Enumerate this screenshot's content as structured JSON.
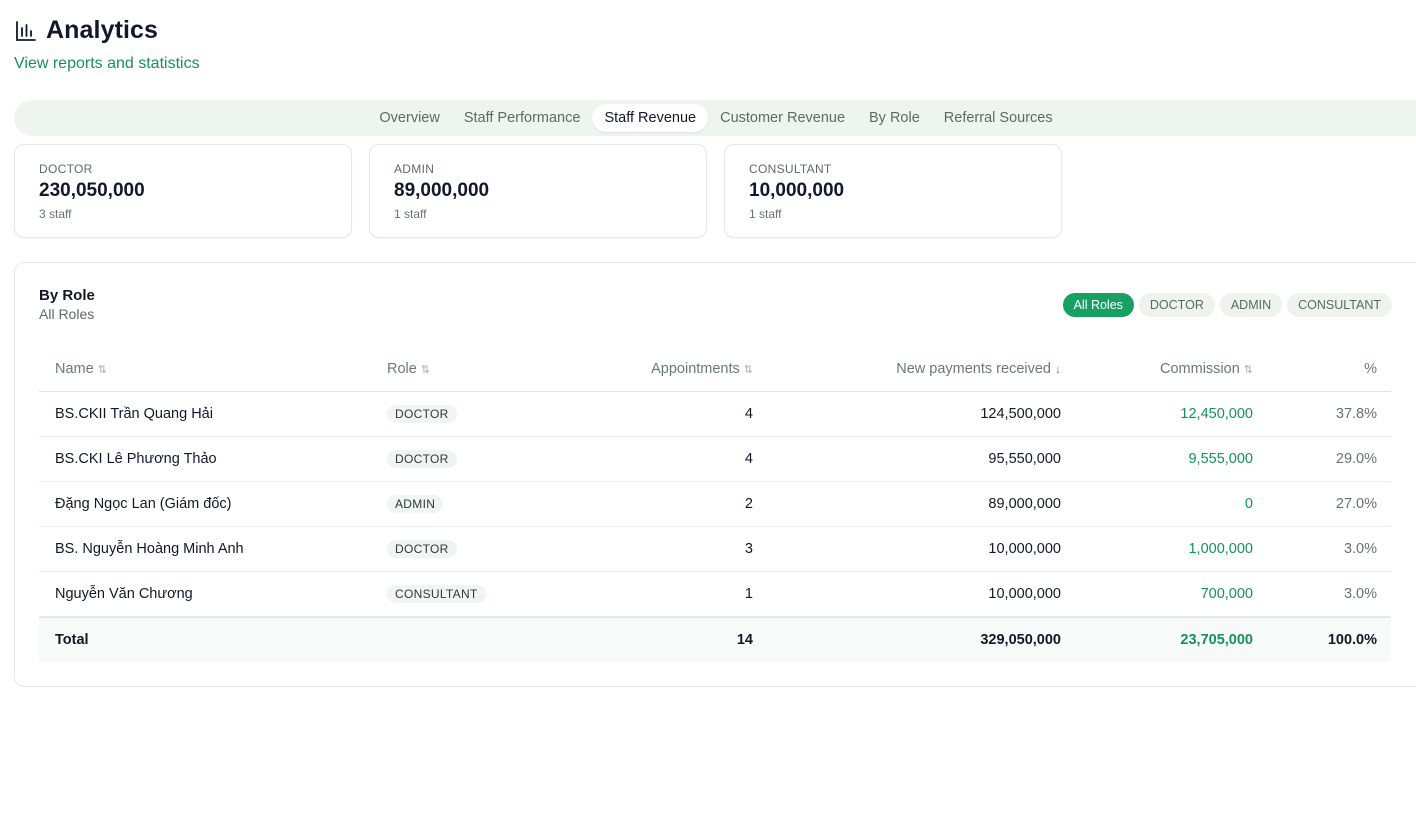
{
  "header": {
    "title": "Analytics",
    "subtitle": "View reports and statistics",
    "icon": "bar-chart-icon"
  },
  "tabs": [
    {
      "label": "Overview",
      "active": false
    },
    {
      "label": "Staff Performance",
      "active": false
    },
    {
      "label": "Staff Revenue",
      "active": true
    },
    {
      "label": "Customer Revenue",
      "active": false
    },
    {
      "label": "By Role",
      "active": false
    },
    {
      "label": "Referral Sources",
      "active": false
    }
  ],
  "cards": [
    {
      "label": "DOCTOR",
      "value": "230,050,000",
      "sub": "3 staff"
    },
    {
      "label": "ADMIN",
      "value": "89,000,000",
      "sub": "1 staff"
    },
    {
      "label": "CONSULTANT",
      "value": "10,000,000",
      "sub": "1 staff"
    }
  ],
  "panel": {
    "title": "By Role",
    "subtitle": "All Roles",
    "filters": [
      {
        "label": "All Roles",
        "active": true
      },
      {
        "label": "DOCTOR",
        "active": false
      },
      {
        "label": "ADMIN",
        "active": false
      },
      {
        "label": "CONSULTANT",
        "active": false
      }
    ]
  },
  "table": {
    "columns": {
      "name": "Name",
      "role": "Role",
      "appointments": "Appointments",
      "payments": "New payments received",
      "commission": "Commission",
      "percent": "%"
    },
    "rows": [
      {
        "name": "BS.CKII Trần Quang Hải",
        "role": "DOCTOR",
        "appointments": "4",
        "payments": "124,500,000",
        "commission": "12,450,000",
        "percent": "37.8%"
      },
      {
        "name": "BS.CKI Lê Phương Thảo",
        "role": "DOCTOR",
        "appointments": "4",
        "payments": "95,550,000",
        "commission": "9,555,000",
        "percent": "29.0%"
      },
      {
        "name": "Đặng Ngọc Lan (Giám đốc)",
        "role": "ADMIN",
        "appointments": "2",
        "payments": "89,000,000",
        "commission": "0",
        "percent": "27.0%"
      },
      {
        "name": "BS. Nguyễn Hoàng Minh Anh",
        "role": "DOCTOR",
        "appointments": "3",
        "payments": "10,000,000",
        "commission": "1,000,000",
        "percent": "3.0%"
      },
      {
        "name": "Nguyễn Văn Chương",
        "role": "CONSULTANT",
        "appointments": "1",
        "payments": "10,000,000",
        "commission": "700,000",
        "percent": "3.0%"
      }
    ],
    "total": {
      "label": "Total",
      "appointments": "14",
      "payments": "329,050,000",
      "commission": "23,705,000",
      "percent": "100.0%"
    }
  },
  "colors": {
    "accent": "#16a062",
    "accent_text": "#16915a",
    "tab_bg": "#eef5f1"
  }
}
